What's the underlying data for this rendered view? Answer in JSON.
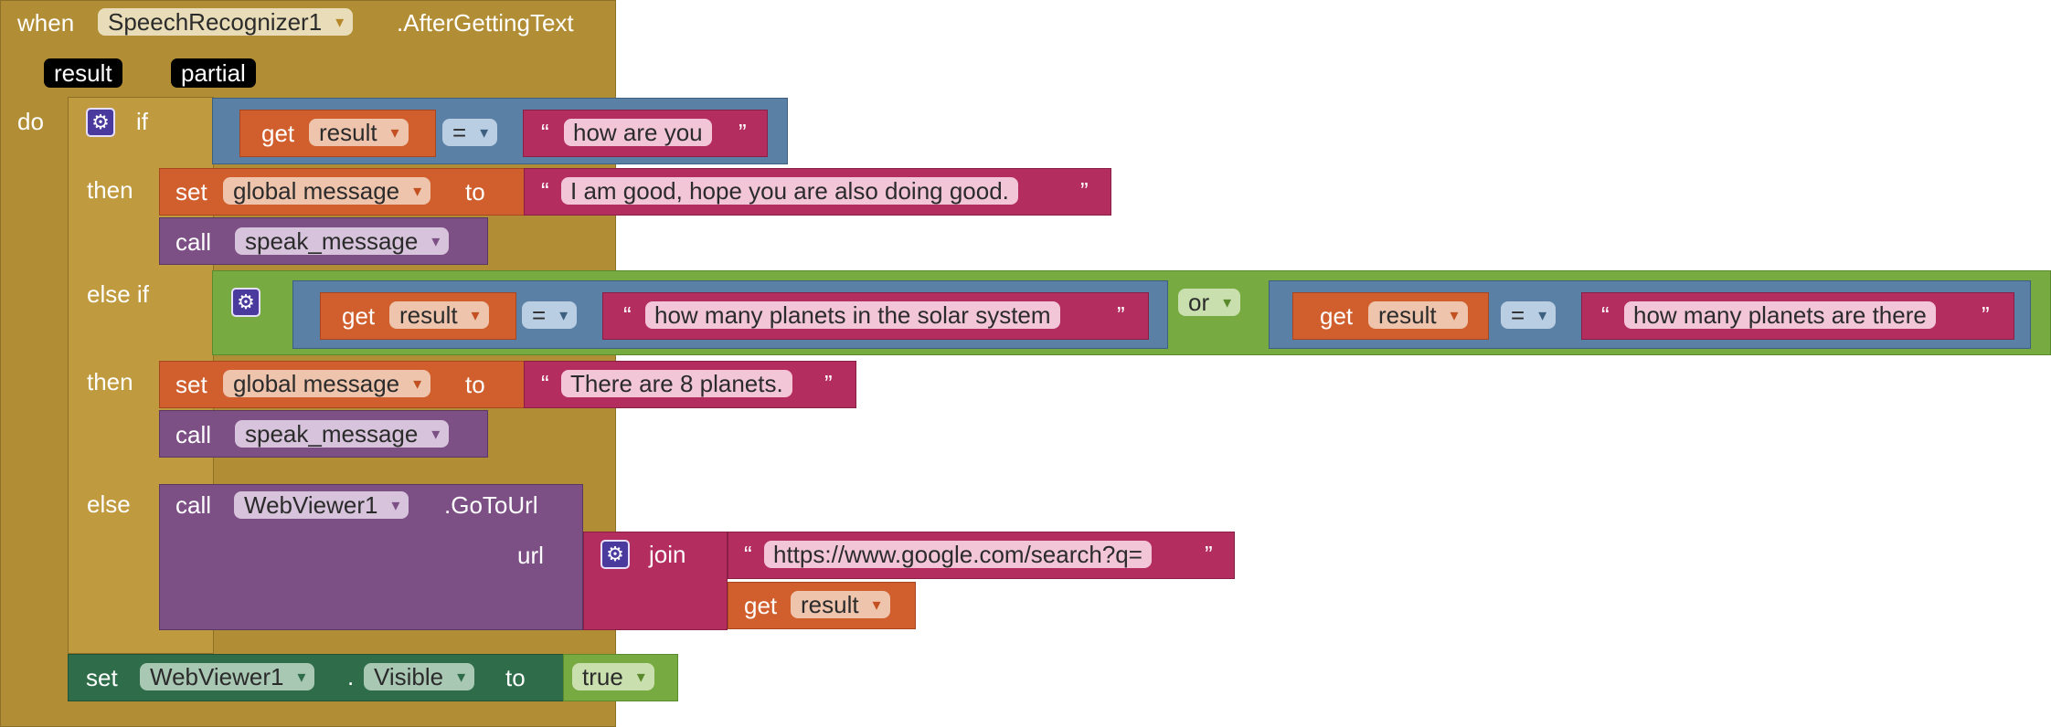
{
  "event": {
    "when": "when",
    "component": "SpeechRecognizer1",
    "event_name": ".AfterGettingText",
    "params": [
      "result",
      "partial"
    ],
    "do": "do"
  },
  "if_block": {
    "if": "if",
    "then": "then",
    "else_if": "else if",
    "else": "else"
  },
  "cond1": {
    "get": "get",
    "var": "result",
    "op": "=",
    "text": "how are you"
  },
  "then1": {
    "set": "set",
    "var": "global message",
    "to": "to",
    "text": "I am good, hope you are also doing good.",
    "call": "call",
    "proc": "speak_message"
  },
  "cond2": {
    "left": {
      "get": "get",
      "var": "result",
      "op": "=",
      "text": "how many planets in the solar system"
    },
    "or": "or",
    "right": {
      "get": "get",
      "var": "result",
      "op": "=",
      "text": "how many planets are there"
    }
  },
  "then2": {
    "set": "set",
    "var": "global message",
    "to": "to",
    "text": "There are 8 planets.",
    "call": "call",
    "proc": "speak_message"
  },
  "else_branch": {
    "call": "call",
    "component": "WebViewer1",
    "method": ".GoToUrl",
    "url": "url",
    "join": "join",
    "text": "https://www.google.com/search?q=",
    "get": "get",
    "var": "result"
  },
  "final_set": {
    "set": "set",
    "component": "WebViewer1",
    "dot": ".",
    "property": "Visible",
    "to": "to",
    "value": "true"
  },
  "quote_open": "“",
  "quote_close": "”",
  "colors": {
    "event": "#b18e35",
    "control": "#c09a3e",
    "logic": "#5b80a5",
    "logic_or": "#77ab41",
    "variable": "#d05f2d",
    "text": "#b32d5e",
    "procedure": "#7c4f85",
    "component": "#2f6d4a"
  }
}
